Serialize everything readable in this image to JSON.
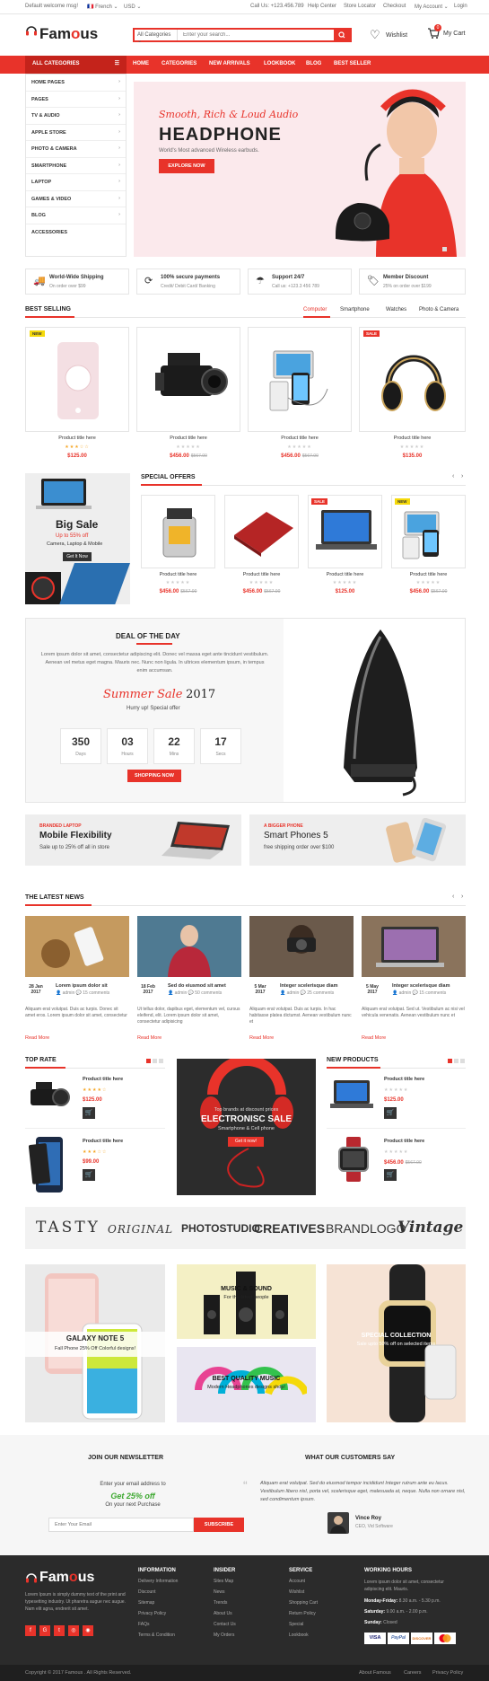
{
  "topbar": {
    "welcome": "Default welcome msg!",
    "lang": "French",
    "currency": "USD",
    "phone": "Call Us: +123.456.789",
    "help": "Help Center",
    "store": "Store Locator",
    "checkout": "Checkout",
    "account": "My Account",
    "login": "Login"
  },
  "header": {
    "logo_a": "Fam",
    "logo_b": "o",
    "logo_c": "us",
    "search_cat": "All Categories",
    "search_ph": "Enter your search...",
    "wishlist": "Wishlist",
    "cart": "My Cart",
    "cart_count": "0"
  },
  "nav": {
    "all_categories": "ALL CATEGORIES",
    "items": [
      "HOME",
      "CATEGORIES",
      "NEW ARRIVALS",
      "LOOKBOOK",
      "BLOG",
      "BEST SELLER"
    ]
  },
  "categories": [
    "HOME PAGES",
    "PAGES",
    "TV & AUDIO",
    "APPLE STORE",
    "PHOTO & CAMERA",
    "SMARTPHONE",
    "LAPTOP",
    "GAMES & VIDEO",
    "BLOG",
    "ACCESSORIES"
  ],
  "hero": {
    "script": "Smooth, Rich & Loud Audio",
    "title": "HEADPHONE",
    "sub": "World's Most advanced Wireless earbuds.",
    "btn": "EXPLORE NOW"
  },
  "features": [
    {
      "t": "World-Wide Shipping",
      "s": "On order over $99"
    },
    {
      "t": "100% secure payments",
      "s": "Credit/ Debit Card/ Banking"
    },
    {
      "t": "Support 24/7",
      "s": "Call us: +123.3 456 789"
    },
    {
      "t": "Member Discount",
      "s": "25% on order over $199"
    }
  ],
  "best": {
    "title": "BEST SELLING",
    "tabs": [
      "Computer",
      "Smartphone",
      "Watches",
      "Photo & Camera"
    ],
    "products": [
      {
        "name": "Product title here",
        "price": "$125.00",
        "old": "",
        "badge": "NEW"
      },
      {
        "name": "Product title here",
        "price": "$456.00",
        "old": "$567.00",
        "badge": ""
      },
      {
        "name": "Product title here",
        "price": "$456.00",
        "old": "$567.00",
        "badge": ""
      },
      {
        "name": "Product title here",
        "price": "$135.00",
        "old": "",
        "badge": "SALE"
      }
    ]
  },
  "bigsale": {
    "title": "Big Sale",
    "sub": "Up to 55% off",
    "cat": "Camera, Laptop & Mobile",
    "btn": "Get It Now"
  },
  "special": {
    "title": "SPECIAL OFFERS",
    "products": [
      {
        "name": "Product title here",
        "price": "$456.00",
        "old": "$567.00",
        "badge": ""
      },
      {
        "name": "Product title here",
        "price": "$456.00",
        "old": "$567.00",
        "badge": ""
      },
      {
        "name": "Product title here",
        "price": "$125.00",
        "old": "",
        "badge": "SALE"
      },
      {
        "name": "Product title here",
        "price": "$456.00",
        "old": "$567.00",
        "badge": "NEW"
      }
    ]
  },
  "deal": {
    "title": "DEAL OF THE DAY",
    "text": "Lorem ipsum dolor sit amet, consectetur adipiscing elit. Donec vel massa eget ante tincidunt vestibulum. Aenean vel metus eget magna. Mauris nec. Nunc non ligula. In ultrices elementum ipsum, in tempus enim accumsan.",
    "sale": "Summer Sale",
    "year": "2017",
    "hurry": "Hurry up! Special offer",
    "timer": [
      {
        "v": "350",
        "l": "Days"
      },
      {
        "v": "03",
        "l": "Hours"
      },
      {
        "v": "22",
        "l": "Mins"
      },
      {
        "v": "17",
        "l": "Secs"
      }
    ],
    "btn": "SHOPPING NOW"
  },
  "banners": [
    {
      "tag": "BRANDED LAPTOP",
      "title": "Mobile Flexibility",
      "sub": "Sale up to 25% off all in store"
    },
    {
      "tag": "A BIGGER PHONE",
      "title": "Smart Phones 5",
      "sub": "free shipping order over $100"
    }
  ],
  "news": {
    "title": "THE LATEST NEWS",
    "items": [
      {
        "date": "28 Jan",
        "year": "2017",
        "title": "Lorem ipsum dolor sit",
        "by": "admin",
        "com": "15 comments",
        "text": "Aliquam erat volutpat. Duis ac turpis. Donec sit amet eros. Lorem ipsum dolor sit amet, consectetur",
        "more": "Read More"
      },
      {
        "date": "18 Feb",
        "year": "2017",
        "title": "Sed do eiusmod sit amet",
        "by": "admin",
        "com": "50 comments",
        "text": "Ut tellus dolor, dapibus eget, elementum vel, cursus eleifend, elit. Lorem ipsum dolor sit amet, consectetur adipisicing",
        "more": "Read More"
      },
      {
        "date": "5 Mar",
        "year": "2017",
        "title": "Integer scelerisque diam",
        "by": "admin",
        "com": "25 comments",
        "text": "Aliquam erat volutpat. Duis ac turpis. In hac habitasse platea dictumst. Aenean vestibulum nunc et",
        "more": "Read More"
      },
      {
        "date": "5 May",
        "year": "2017",
        "title": "Integer scelerisque diam",
        "by": "admin",
        "com": "15 comments",
        "text": "Aliquam erat volutpat. Sed ut. Vestibulum ac nisi vel vehicula venenatis. Aenean vestibulum nunc et",
        "more": "Read More"
      }
    ]
  },
  "toprate": {
    "title": "TOP RATE",
    "items": [
      {
        "name": "Product title here",
        "price": "$125.00"
      },
      {
        "name": "Product title here",
        "price": "$99.00"
      }
    ]
  },
  "promo": {
    "line1": "Top brands at discount prices",
    "title": "ELECTRONISC SALE",
    "sub": "Smartphone & Cell phone",
    "btn": "Get it now!"
  },
  "newprod": {
    "title": "NEW PRODUCTS",
    "items": [
      {
        "name": "Product title here",
        "price": "$125.00"
      },
      {
        "name": "Product title here",
        "price": "$456.00",
        "old": "$567.00"
      }
    ]
  },
  "brands": [
    "TASTY",
    "ORIGINAL",
    "PHOTOSTUDIO",
    "CREATIVES",
    "BRANDLOGO",
    "Vintage"
  ],
  "tiles": {
    "galaxy": {
      "t": "GALAXY NOTE 5",
      "s": "Fall Phone 25% Off Colorful designs!"
    },
    "music": {
      "t": "MUSIC & SOUND",
      "s": "For the fittest people"
    },
    "best": {
      "t": "BEST QUALITY MUSIC",
      "s": "Modern Headphones designs shop!"
    },
    "coll": {
      "t": "SPECIAL COLLECTION",
      "s": "Sale upto 50% off on selected items"
    }
  },
  "newsletter": {
    "title": "JOIN OUR NEWSLETTER",
    "l1": "Enter your email address to",
    "l2": "Get 25% off",
    "l3": "On your next Purchase",
    "ph": "Enter Your Email",
    "btn": "SUBSCRIBE"
  },
  "testimonial": {
    "title": "WHAT OUR CUSTOMERS SAY",
    "text": "Aliquam erat volutpat. Sed do eiusmod tempor incididunt Integer rutrum ante eu lacus. Vestibulum libero nisl, porta vel, scelerisque eget, malesuada at, neque. Nulla non ornare nisl, sed condimentum ipsum.",
    "name": "Vince Roy",
    "role": "CEO, Vid Software"
  },
  "footer": {
    "about": "Lorem Ipsum is simply dummy text of the print and typesetting industry. Ut pharetra augue nec augue. Nam elit agna, endrerit sit amet.",
    "info": {
      "t": "INFORMATION",
      "items": [
        "Delivery Information",
        "Discount",
        "Sitemap",
        "Privacy Policy",
        "FAQs",
        "Terms & Condition"
      ]
    },
    "insider": {
      "t": "INSIDER",
      "items": [
        "Sites Map",
        "News",
        "Trends",
        "About Us",
        "Contact Us",
        "My Orders"
      ]
    },
    "service": {
      "t": "SERVICE",
      "items": [
        "Account",
        "Wishlist",
        "Shopping Cart",
        "Return Policy",
        "Special",
        "Lookbook"
      ]
    },
    "hours": {
      "t": "WORKING HOURS",
      "text": "Lorem ipsum dolor sit amet, consectetur adipiscing elit. Mauris.",
      "mf": "Monday-Friday:",
      "mft": "8.30 a.m. - 5.30 p.m.",
      "sa": "Saturday:",
      "sat": "9.00 a.m. - 2.00 p.m.",
      "su": "Sunday:",
      "sut": "Closed"
    },
    "pay": [
      "VISA",
      "PayPal",
      "DISCOVER",
      "MC"
    ]
  },
  "copyright": {
    "text": "Copyright © 2017 Famous . All Rights Reserved.",
    "links": [
      "About Famous",
      "Careers",
      "Privacy Policy"
    ]
  }
}
